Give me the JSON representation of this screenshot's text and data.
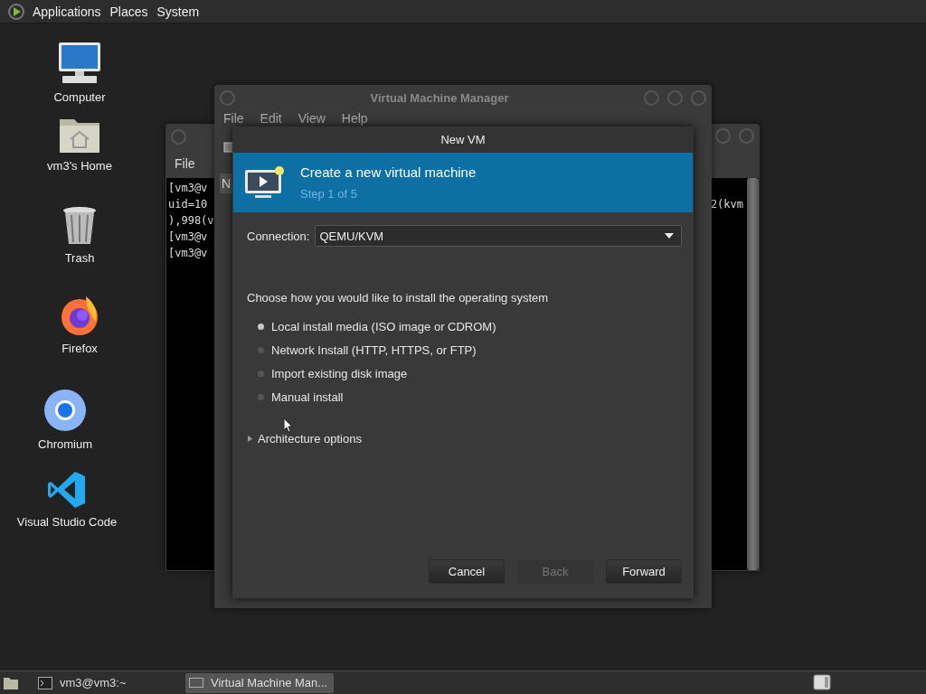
{
  "top_panel": {
    "menus": [
      {
        "label": "Applications"
      },
      {
        "label": "Places"
      },
      {
        "label": "System"
      }
    ]
  },
  "desktop_icons": [
    {
      "label": "Computer",
      "kind": "computer"
    },
    {
      "label": "vm3's Home",
      "kind": "home"
    },
    {
      "label": "Trash",
      "kind": "trash"
    },
    {
      "label": "Firefox",
      "kind": "firefox"
    },
    {
      "label": "Chromium",
      "kind": "chromium"
    },
    {
      "label": "Visual Studio Code",
      "kind": "vscode"
    }
  ],
  "terminal": {
    "menu": [
      "File"
    ],
    "lines": [
      "[vm3@v",
      "uid=10",
      "),998(v",
      "[vm3@v",
      "[vm3@v"
    ],
    "right_fragment": "2(kvm"
  },
  "manager": {
    "title": "Virtual Machine Manager",
    "menu": [
      "File",
      "Edit",
      "View",
      "Help"
    ],
    "column_header": "N"
  },
  "dialog": {
    "title": "New VM",
    "header": {
      "title": "Create a new virtual machine",
      "step": "Step 1 of 5"
    },
    "connection": {
      "label": "Connection:",
      "value": "QEMU/KVM"
    },
    "prompt": "Choose how you would like to install the operating system",
    "options": [
      {
        "label": "Local install media (ISO image or CDROM)",
        "selected": true
      },
      {
        "label": "Network Install (HTTP, HTTPS, or FTP)",
        "selected": false
      },
      {
        "label": "Import existing disk image",
        "selected": false
      },
      {
        "label": "Manual install",
        "selected": false
      }
    ],
    "expander": {
      "label": "Architecture options",
      "expanded": false
    },
    "buttons": [
      {
        "label": "Cancel",
        "disabled": false
      },
      {
        "label": "Back",
        "disabled": true
      },
      {
        "label": "Forward",
        "disabled": false
      }
    ]
  },
  "taskbar": {
    "tasks": [
      {
        "label": "vm3@vm3:~",
        "selected": false,
        "kind": "terminal"
      },
      {
        "label": "Virtual Machine Man...",
        "selected": true,
        "kind": "manager"
      }
    ]
  }
}
